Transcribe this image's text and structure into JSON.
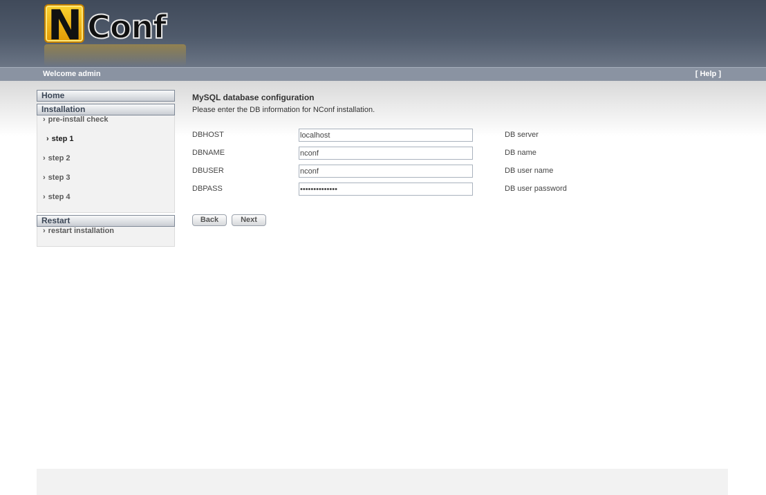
{
  "logo": {
    "first_letter": "N",
    "rest": "Conf"
  },
  "header": {
    "welcome": "Welcome admin",
    "help": "[ Help ]"
  },
  "sidebar": {
    "home": "Home",
    "installation": "Installation",
    "items": [
      {
        "label": "pre-install check",
        "active": false
      },
      {
        "label": "step 1",
        "active": true
      },
      {
        "label": "step 2",
        "active": false
      },
      {
        "label": "step 3",
        "active": false
      },
      {
        "label": "step 4",
        "active": false
      }
    ],
    "restart_header": "Restart",
    "restart_item": "restart installation",
    "chevron": "›"
  },
  "main": {
    "title": "MySQL database configuration",
    "description": "Please enter the DB information for NConf installation.",
    "fields": [
      {
        "label": "DBHOST",
        "value": "localhost",
        "hint": "DB server",
        "type": "text"
      },
      {
        "label": "DBNAME",
        "value": "nconf",
        "hint": "DB name",
        "type": "text"
      },
      {
        "label": "DBUSER",
        "value": "nconf",
        "hint": "DB user name",
        "type": "text"
      },
      {
        "label": "DBPASS",
        "value": "nconfpassword1",
        "hint": "DB user password",
        "type": "password"
      }
    ],
    "back_label": "Back",
    "next_label": "Next"
  }
}
